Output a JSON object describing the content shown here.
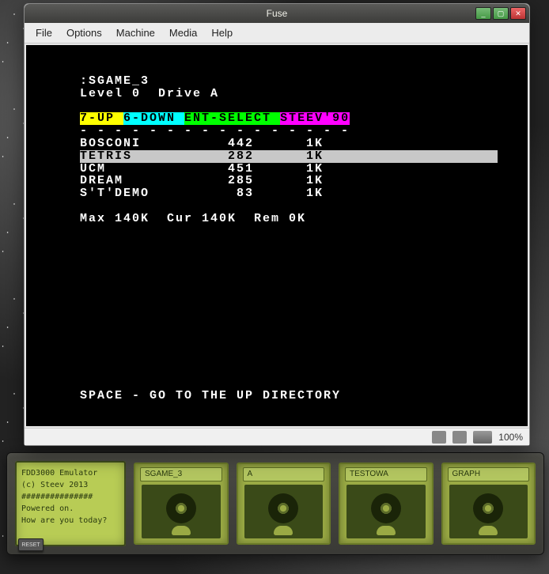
{
  "window": {
    "title": "Fuse",
    "menu": [
      "File",
      "Options",
      "Machine",
      "Media",
      "Help"
    ],
    "status": {
      "zoom": "100%"
    }
  },
  "screen": {
    "prompt": ":SGAME_3",
    "level_line": "Level 0  Drive A",
    "banner": {
      "up": "7-UP ",
      "down": "6-DOWN ",
      "select": "ENT-SELECT ",
      "author": "STEEV'90"
    },
    "dashes": "- - - - - - - - - - - - - - - -",
    "files": [
      {
        "name": "BOSCONI",
        "size": "442",
        "k": "1K",
        "selected": false
      },
      {
        "name": "TETRIS",
        "size": "282",
        "k": "1K",
        "selected": true
      },
      {
        "name": "UCM",
        "size": "451",
        "k": "1K",
        "selected": false
      },
      {
        "name": "DREAM",
        "size": "285",
        "k": "1K",
        "selected": false
      },
      {
        "name": "S'T'DEMO",
        "size": "83",
        "k": "1K",
        "selected": false
      }
    ],
    "capacity": "Max 140K  Cur 140K  Rem 0K",
    "hint": "SPACE - GO TO THE UP DIRECTORY"
  },
  "fdd": {
    "lcd": [
      "FDD3000 Emulator",
      "(c) Steev 2013",
      "###############",
      "Powered on.",
      "How are you today?"
    ],
    "reset": "RESET",
    "drives": [
      "SGAME_3",
      "A",
      "TESTOWA",
      "GRAPH"
    ]
  }
}
